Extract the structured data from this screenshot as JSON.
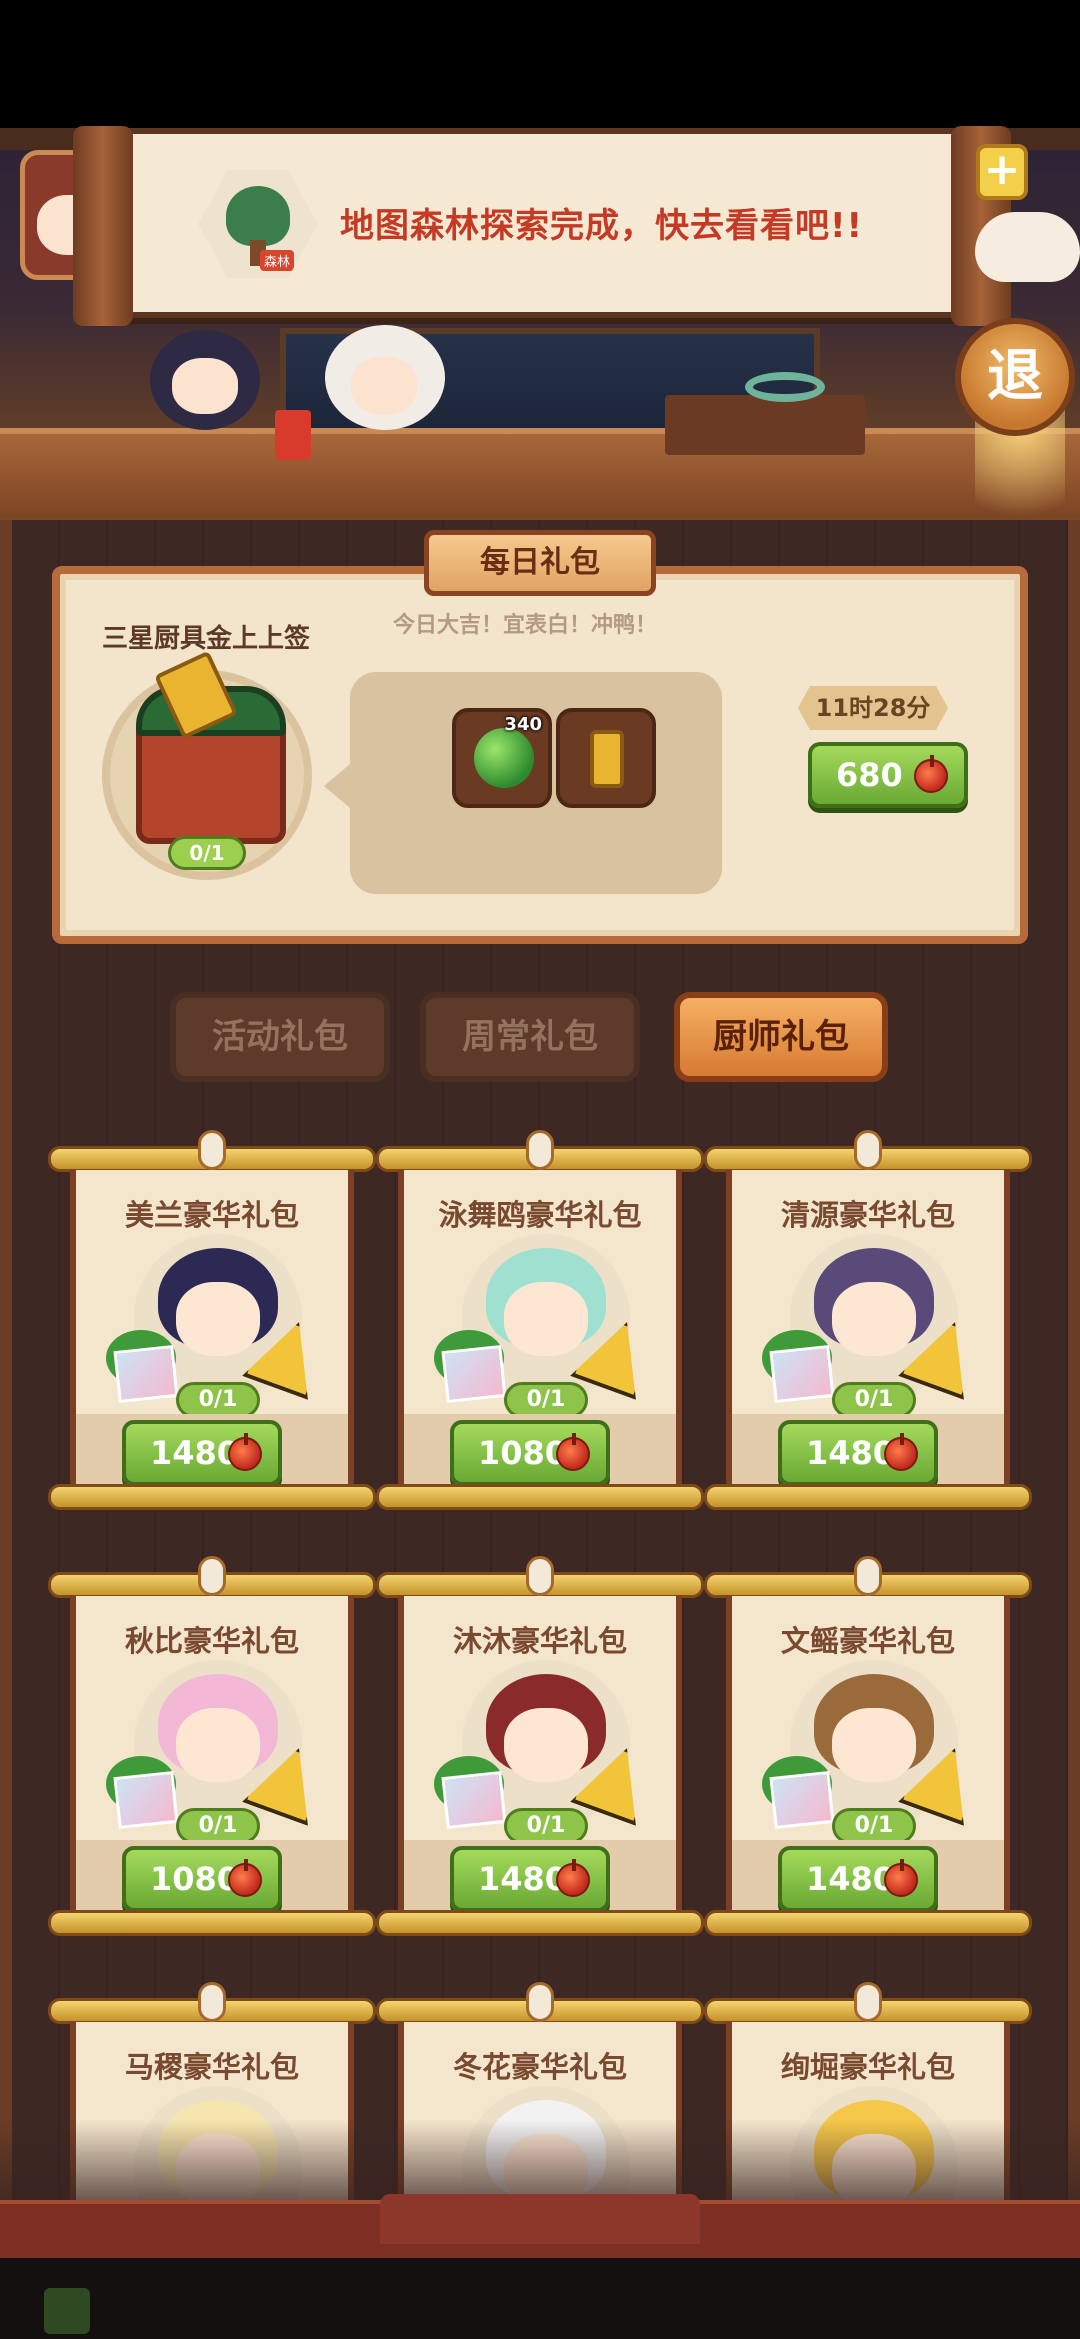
{
  "notification": {
    "thumb_tag": "森林",
    "message": "地图森林探索完成，快去看看吧!!"
  },
  "top_buttons": {
    "plus_label": "+",
    "exit_label": "退"
  },
  "daily_pack": {
    "header": "每日礼包",
    "name": "三星厨具金上上签",
    "slogan": "今日大吉！宜表白！冲鸭！",
    "count": "0/1",
    "items": [
      {
        "icon": "jade-coin-icon",
        "amount": "340"
      },
      {
        "icon": "bamboo-sticks-icon",
        "amount": ""
      }
    ],
    "timer": "11时28分",
    "price": "680"
  },
  "tabs": [
    {
      "label": "活动礼包",
      "active": false
    },
    {
      "label": "周常礼包",
      "active": false
    },
    {
      "label": "厨师礼包",
      "active": true
    }
  ],
  "chef_packs": [
    {
      "name": "美兰豪华礼包",
      "count": "0/1",
      "price": "1480",
      "hair": "#2c2a55"
    },
    {
      "name": "泳舞鸥豪华礼包",
      "count": "0/1",
      "price": "1080",
      "hair": "#9fe0d0"
    },
    {
      "name": "清源豪华礼包",
      "count": "0/1",
      "price": "1480",
      "hair": "#5a4a7a"
    },
    {
      "name": "秋比豪华礼包",
      "count": "0/1",
      "price": "1080",
      "hair": "#f3b8d6"
    },
    {
      "name": "沐沐豪华礼包",
      "count": "0/1",
      "price": "1480",
      "hair": "#8a2a2a"
    },
    {
      "name": "文鳐豪华礼包",
      "count": "0/1",
      "price": "1480",
      "hair": "#9a6a3a"
    },
    {
      "name": "马稷豪华礼包",
      "count": "",
      "price": "",
      "hair": "#f5e6b0"
    },
    {
      "name": "冬花豪华礼包",
      "count": "",
      "price": "",
      "hair": "#f2f2f2"
    },
    {
      "name": "绚堀豪华礼包",
      "count": "",
      "price": "",
      "hair": "#f5c84a"
    }
  ]
}
